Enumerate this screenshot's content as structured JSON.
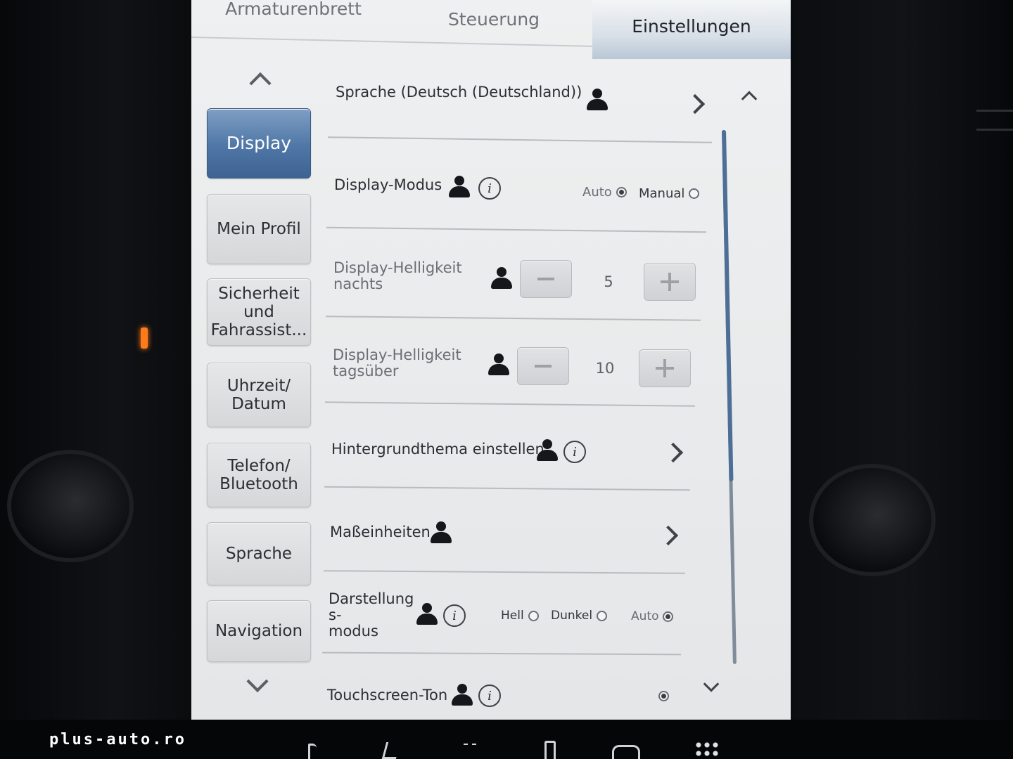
{
  "tabs": [
    {
      "label": "Armaturenbrett",
      "active": false
    },
    {
      "label": "Steuerung",
      "active": false
    },
    {
      "label": "Einstellungen",
      "active": true
    }
  ],
  "sidebar": {
    "items": [
      {
        "label": "Display",
        "active": true
      },
      {
        "label": "Mein Profil",
        "active": false
      },
      {
        "label": "Sicherheit\nund\nFahrassist...",
        "active": false
      },
      {
        "label": "Uhrzeit/\nDatum",
        "active": false
      },
      {
        "label": "Telefon/\nBluetooth",
        "active": false
      },
      {
        "label": "Sprache",
        "active": false
      },
      {
        "label": "Navigation",
        "active": false
      }
    ]
  },
  "settings": {
    "language": {
      "label": "Sprache  (Deutsch (Deutschland))"
    },
    "display_mode": {
      "label": "Display-Modus",
      "options": [
        "Auto",
        "Manual"
      ],
      "selected": "Auto"
    },
    "brightness_night": {
      "label": "Display-Helligkeit\nnachts",
      "value": "5"
    },
    "brightness_day": {
      "label": "Display-Helligkeit\ntagsüber",
      "value": "10"
    },
    "background_theme": {
      "label": "Hintergrundthema einstellen"
    },
    "units": {
      "label": "Maßeinheiten"
    },
    "appearance_mode": {
      "label": "Darstellung\ns-\nmodus",
      "options": [
        "Hell",
        "Dunkel",
        "Auto"
      ],
      "selected": "Auto"
    },
    "touch_sound": {
      "label": "Touchscreen-Ton",
      "enabled": true
    }
  },
  "watermark": "plus-auto.ro",
  "colors": {
    "active_tab": "#b9c7d6",
    "active_sidebar": "#4e76a6",
    "scrollbar": "#4d6f97"
  },
  "icons": [
    "person-icon",
    "info-icon",
    "chevron-right-icon",
    "chevron-up-icon",
    "chevron-down-icon",
    "minus-icon",
    "plus-icon"
  ]
}
